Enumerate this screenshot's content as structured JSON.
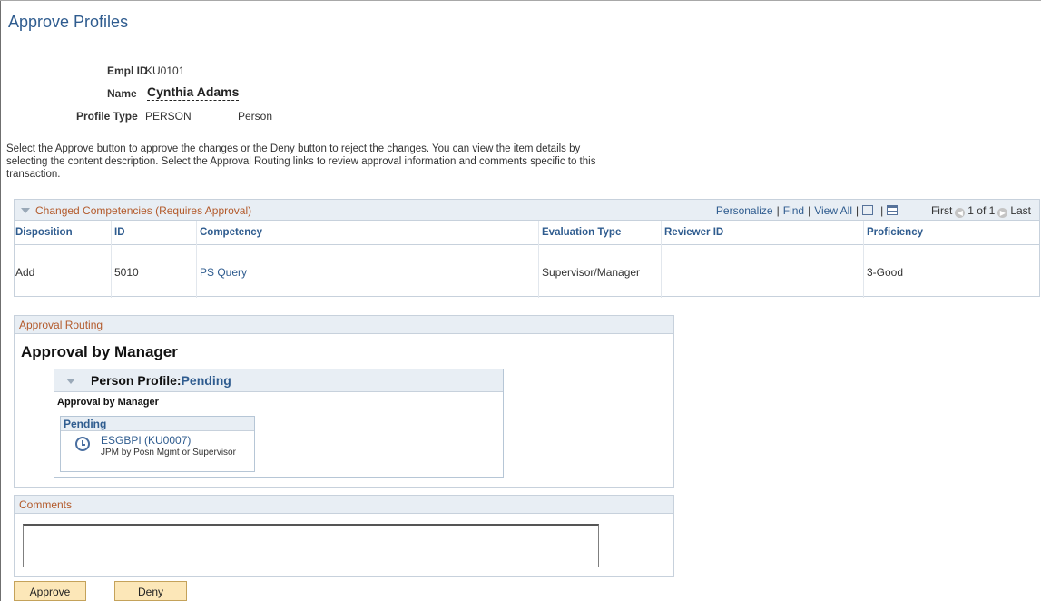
{
  "page": {
    "title": "Approve Profiles"
  },
  "employee": {
    "empl_id_label": "Empl ID",
    "empl_id": "KU0101",
    "name_label": "Name",
    "name": "Cynthia Adams",
    "profile_type_label": "Profile Type",
    "profile_type_code": "PERSON",
    "profile_type_desc": "Person"
  },
  "instructions": "Select the Approve button to approve the changes or the Deny button to reject the changes. You can view the item details by selecting the content description. Select the Approval Routing links to review approval information and comments specific to this transaction.",
  "grid": {
    "title": "Changed Competencies (Requires Approval)",
    "nav": {
      "personalize": "Personalize",
      "find": "Find",
      "view_all": "View All",
      "first": "First",
      "range": "1 of 1",
      "last": "Last"
    },
    "columns": [
      "Disposition",
      "ID",
      "Competency",
      "Evaluation Type",
      "Reviewer ID",
      "Proficiency"
    ],
    "rows": [
      {
        "disposition": "Add",
        "id": "5010",
        "competency": "PS Query",
        "evaluation_type": "Supervisor/Manager",
        "reviewer_id": "",
        "proficiency": "3-Good"
      }
    ]
  },
  "routing": {
    "section_title": "Approval Routing",
    "approval_title": "Approval by Manager",
    "profile_label": "Person Profile:",
    "profile_status": "Pending",
    "stage_label": "Approval by Manager",
    "step_status": "Pending",
    "approver": "ESGBPI (KU0007)",
    "approver_role": "JPM by Posn Mgmt or Supervisor"
  },
  "comments": {
    "section_title": "Comments",
    "value": ""
  },
  "buttons": {
    "approve": "Approve",
    "deny": "Deny"
  }
}
